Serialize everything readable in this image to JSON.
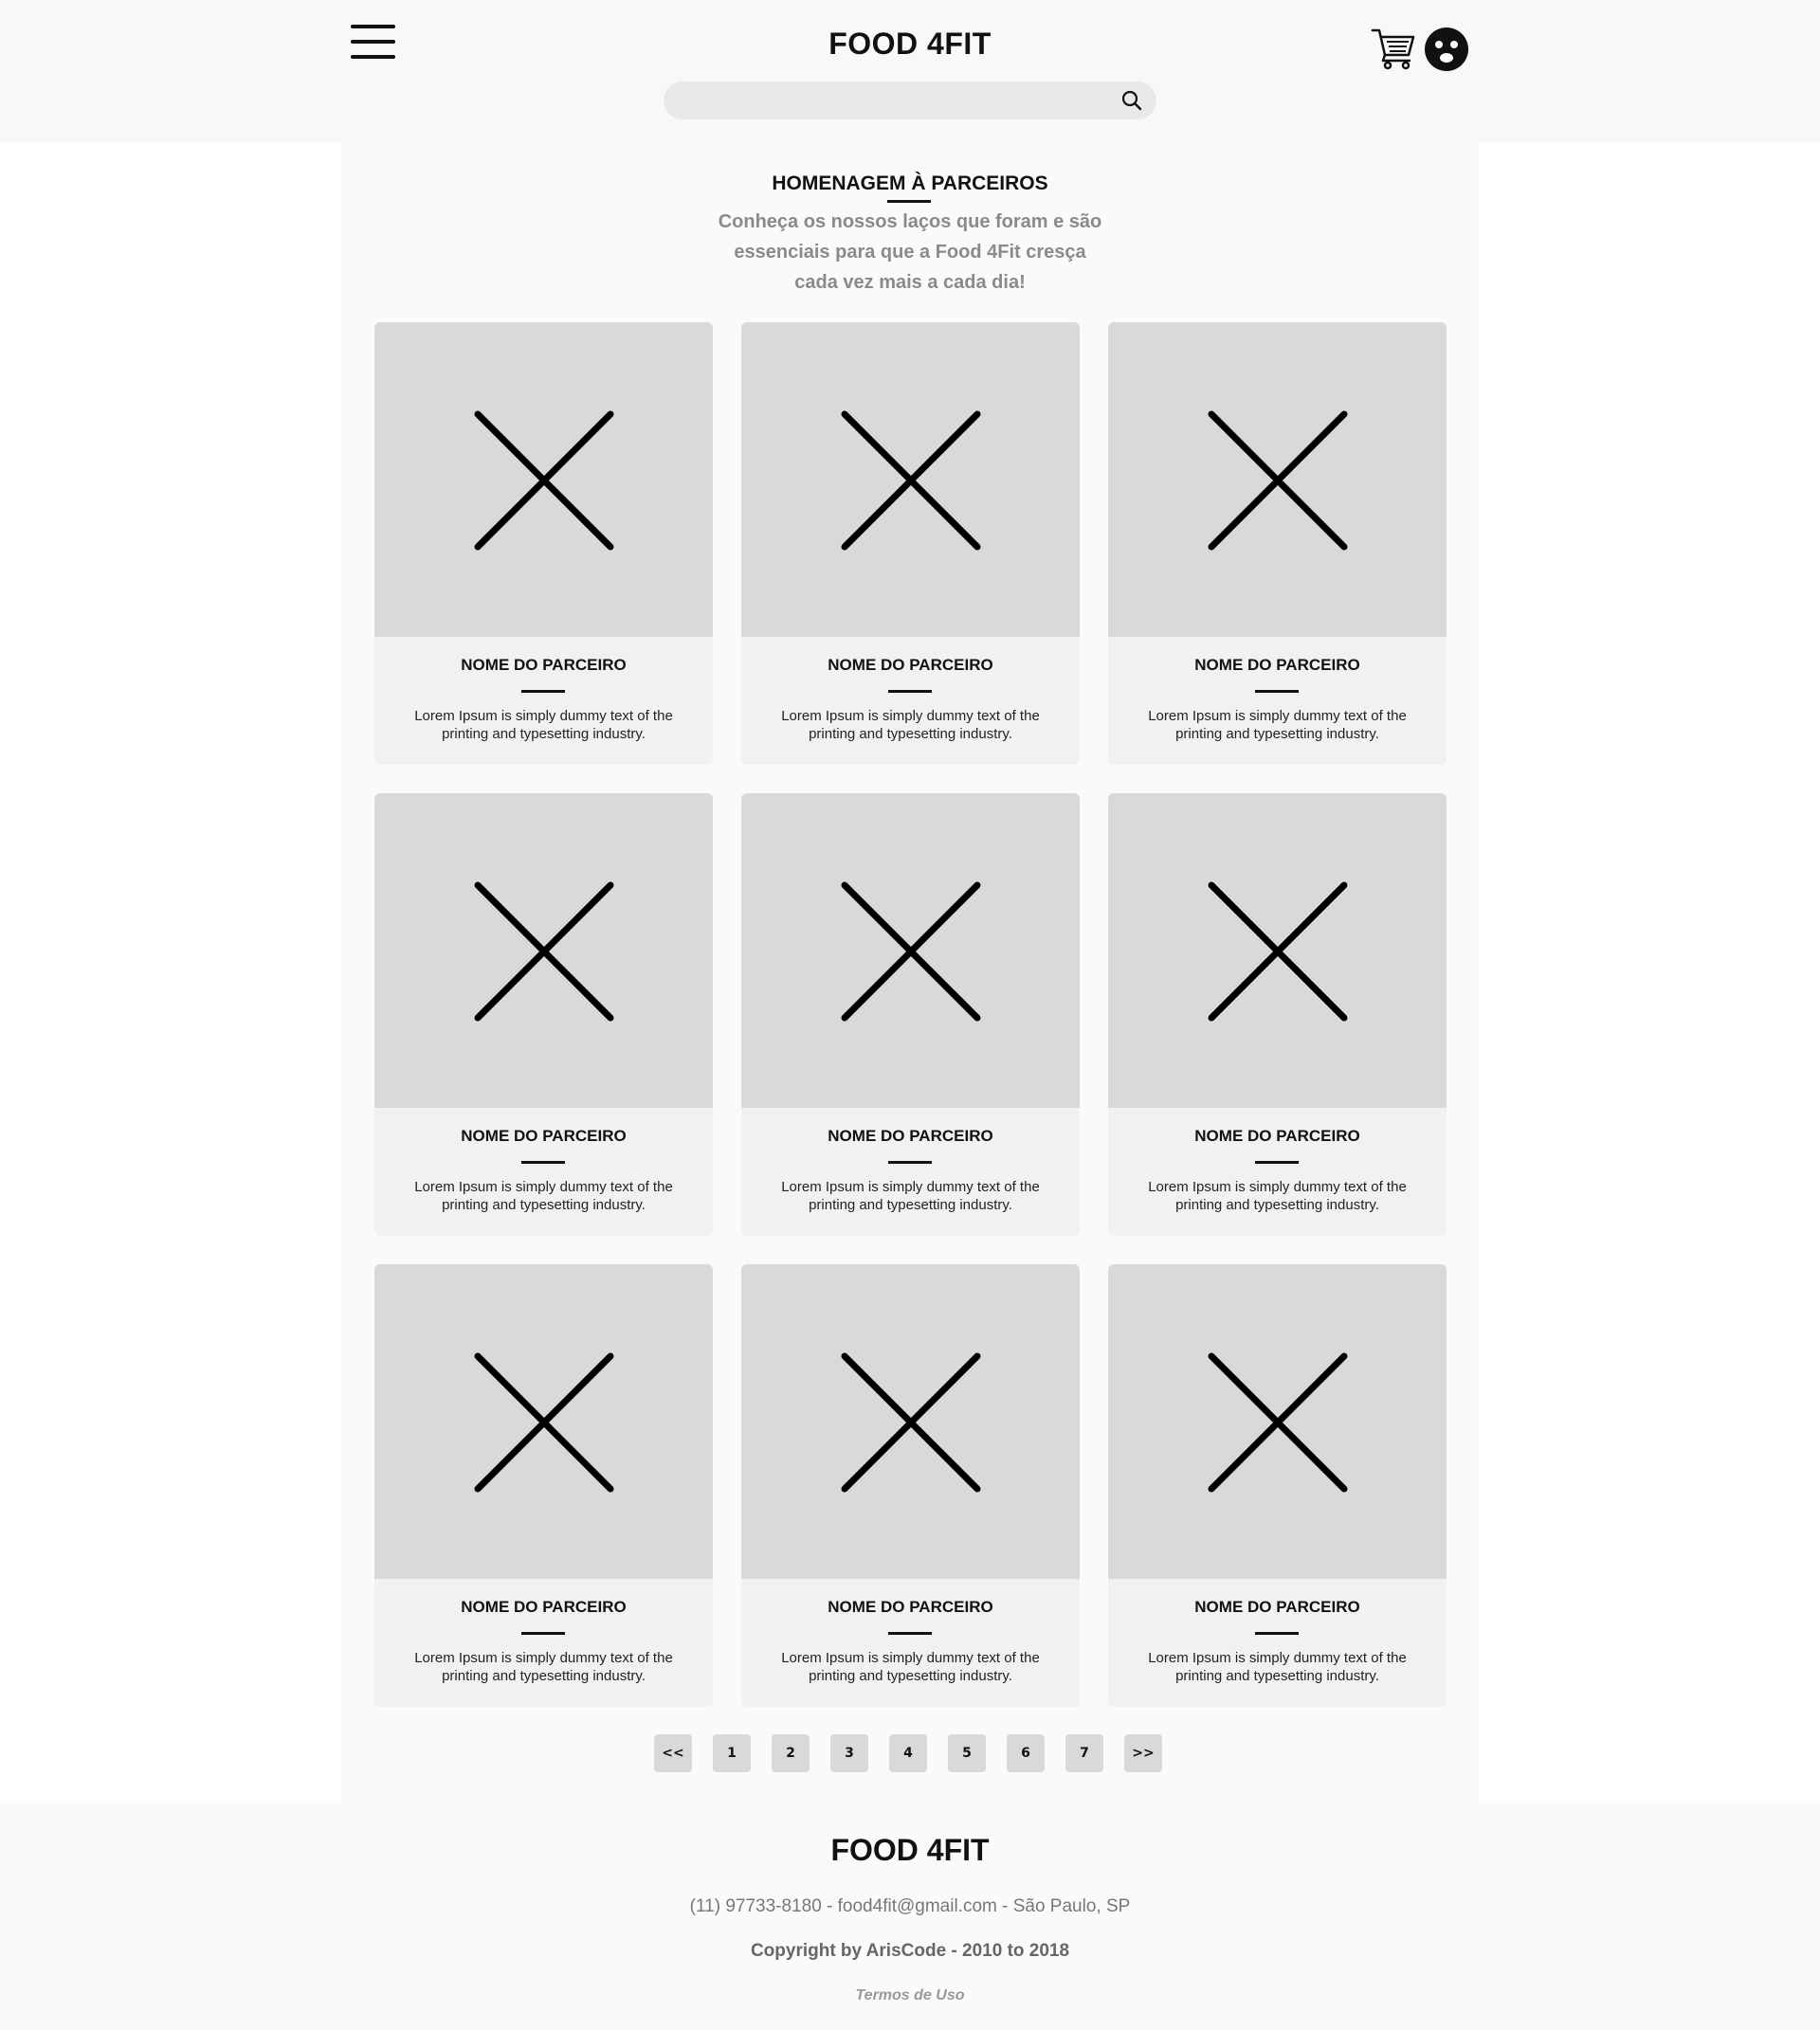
{
  "header": {
    "brand": "FOOD 4FIT",
    "menu_icon": "hamburger-menu-icon",
    "cart_icon": "shopping-cart-icon",
    "avatar_icon": "user-avatar-icon",
    "search": {
      "placeholder": "",
      "value": "",
      "icon": "search-icon"
    }
  },
  "main": {
    "title": "HOMENAGEM À PARCEIROS",
    "subtitle": "Conheça os nossos laços que foram e são\nessenciais para que a Food  4Fit cresça\ncada vez mais a cada dia!",
    "partners": [
      {
        "name": "NOME DO PARCEIRO",
        "description": "Lorem Ipsum is simply dummy text of the printing and typesetting industry.",
        "image_icon": "image-placeholder-icon"
      },
      {
        "name": "NOME DO PARCEIRO",
        "description": "Lorem Ipsum is simply dummy text of the printing and typesetting industry.",
        "image_icon": "image-placeholder-icon"
      },
      {
        "name": "NOME DO PARCEIRO",
        "description": "Lorem Ipsum is simply dummy text of the printing and typesetting industry.",
        "image_icon": "image-placeholder-icon"
      },
      {
        "name": "NOME DO PARCEIRO",
        "description": "Lorem Ipsum is simply dummy text of the printing and typesetting industry.",
        "image_icon": "image-placeholder-icon"
      },
      {
        "name": "NOME DO PARCEIRO",
        "description": "Lorem Ipsum is simply dummy text of the printing and typesetting industry.",
        "image_icon": "image-placeholder-icon"
      },
      {
        "name": "NOME DO PARCEIRO",
        "description": "Lorem Ipsum is simply dummy text of the printing and typesetting industry.",
        "image_icon": "image-placeholder-icon"
      },
      {
        "name": "NOME DO PARCEIRO",
        "description": "Lorem Ipsum is simply dummy text of the printing and typesetting industry.",
        "image_icon": "image-placeholder-icon"
      },
      {
        "name": "NOME DO PARCEIRO",
        "description": "Lorem Ipsum is simply dummy text of the printing and typesetting industry.",
        "image_icon": "image-placeholder-icon"
      },
      {
        "name": "NOME DO PARCEIRO",
        "description": "Lorem Ipsum is simply dummy text of the printing and typesetting industry.",
        "image_icon": "image-placeholder-icon"
      }
    ]
  },
  "pagination": {
    "first": "<<",
    "pages": [
      "1",
      "2",
      "3",
      "4",
      "5",
      "6",
      "7"
    ],
    "last": ">>"
  },
  "footer": {
    "brand": "FOOD 4FIT",
    "contact": "(11) 97733-8180 - food4fit@gmail.com - São Paulo, SP",
    "copyright": "Copyright by ArisCode - 2010 to 2018",
    "terms": "Termos de Uso"
  },
  "colors": {
    "page_bg": "#f8f8f8",
    "card_bg": "#f1f1f1",
    "image_bg": "#d9d9d9",
    "subtitle_text": "#8a8a8a",
    "page_button_bg": "#d9d9d9"
  }
}
